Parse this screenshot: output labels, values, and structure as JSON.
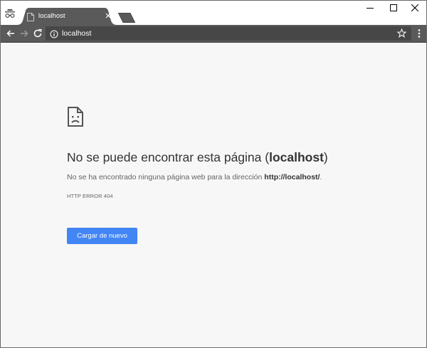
{
  "browser": {
    "tab": {
      "title": "localhost"
    },
    "window_controls": {
      "minimize": "minimize-icon",
      "maximize": "maximize-icon",
      "close": "close-icon"
    },
    "toolbar": {
      "url": "localhost",
      "back": "back-arrow-icon",
      "forward": "forward-arrow-icon",
      "reload": "reload-icon",
      "site_info": "info-icon",
      "bookmark": "star-icon",
      "menu": "kebab-menu-icon"
    }
  },
  "error_page": {
    "icon": "sad-page-icon",
    "heading_prefix": "No se puede encontrar esta página (",
    "heading_host": "localhost",
    "heading_suffix": ")",
    "description_prefix": "No se ha encontrado ninguna página web para la dirección ",
    "description_url": "http://localhost/",
    "description_suffix": ".",
    "error_code": "HTTP ERROR 404",
    "reload_button": "Cargar de nuevo"
  },
  "colors": {
    "toolbar_bg": "#5a5a5a",
    "omnibox_bg": "#474747",
    "tab_bg": "#5a5a5a",
    "page_bg": "#f7f7f7",
    "button_blue": "#4285f4"
  }
}
